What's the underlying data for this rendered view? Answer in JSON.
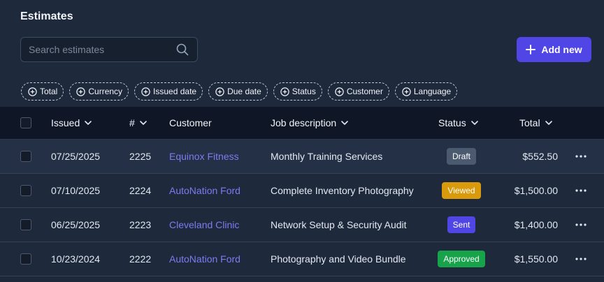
{
  "page_title": "Estimates",
  "search": {
    "placeholder": "Search estimates",
    "icon": "search-icon"
  },
  "add_button": {
    "label": "Add new",
    "icon": "plus-icon"
  },
  "filters": [
    "Total",
    "Currency",
    "Issued date",
    "Due date",
    "Status",
    "Customer",
    "Language"
  ],
  "columns": {
    "issued": "Issued",
    "number": "#",
    "customer": "Customer",
    "job": "Job description",
    "status": "Status",
    "total": "Total"
  },
  "rows": [
    {
      "issued": "07/25/2025",
      "number": "2225",
      "customer": "Equinox Fitness",
      "job": "Monthly Training Services",
      "status": "Draft",
      "total": "$552.50"
    },
    {
      "issued": "07/10/2025",
      "number": "2224",
      "customer": "AutoNation Ford",
      "job": "Complete Inventory Photography",
      "status": "Viewed",
      "total": "$1,500.00"
    },
    {
      "issued": "06/25/2025",
      "number": "2223",
      "customer": "Cleveland Clinic",
      "job": "Network Setup & Security Audit",
      "status": "Sent",
      "total": "$1,400.00"
    },
    {
      "issued": "10/23/2024",
      "number": "2222",
      "customer": "AutoNation Ford",
      "job": "Photography and Video Bundle",
      "status": "Approved",
      "total": "$1,550.00"
    }
  ],
  "status_colors": {
    "Draft": "#4b5a6e",
    "Viewed": "#d99a0b",
    "Sent": "#4f46e5",
    "Approved": "#16a34a"
  },
  "colors": {
    "accent": "#4f46e5",
    "link": "#7c7cf0",
    "background": "#1e293b"
  }
}
